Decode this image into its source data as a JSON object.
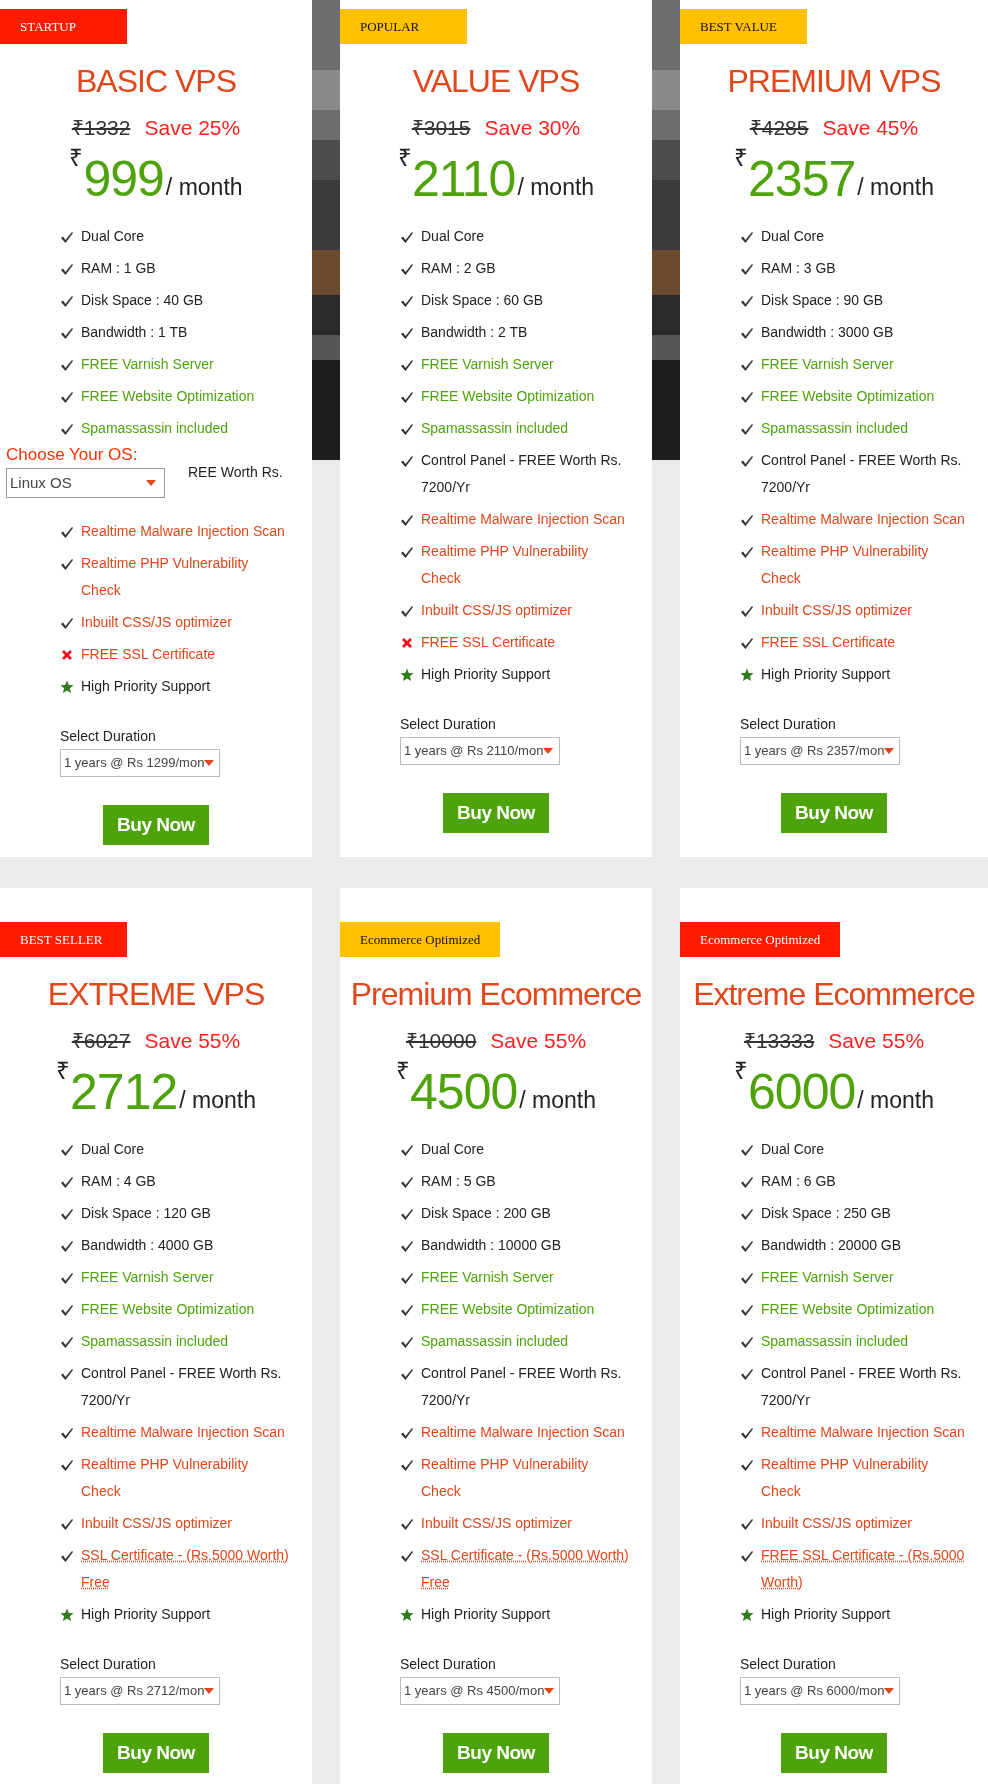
{
  "os_chooser": {
    "label": "Choose Your OS:",
    "value": "Linux OS"
  },
  "plans": [
    {
      "badge": {
        "text": "STARTUP",
        "color": "#ff1a00"
      },
      "title": "BASIC VPS",
      "old_price": "₹1332",
      "save": "Save 25%",
      "currency": "₹",
      "price": "999",
      "per": "/ month",
      "features": [
        {
          "kind": "check",
          "color": "#222222",
          "lines": [
            "Dual Core"
          ]
        },
        {
          "kind": "check",
          "color": "#222222",
          "lines": [
            "RAM : 1 GB"
          ]
        },
        {
          "kind": "check",
          "color": "#222222",
          "lines": [
            "Disk Space : 40 GB"
          ]
        },
        {
          "kind": "check",
          "color": "#222222",
          "lines": [
            "Bandwidth : 1 TB"
          ]
        },
        {
          "kind": "check",
          "color": "#4ea30a",
          "lines": [
            "FREE Varnish Server"
          ]
        },
        {
          "kind": "check",
          "color": "#4ea30a",
          "lines": [
            "FREE Website Optimization"
          ]
        },
        {
          "kind": "check",
          "color": "#4ea30a",
          "lines": [
            "Spamassassin included"
          ]
        },
        {
          "kind": "covered",
          "color": "#222222",
          "lines": [
            "REE Worth Rs."
          ]
        },
        {
          "kind": "check",
          "color": "#e2461b",
          "lines": [
            "Realtime Malware Injection Scan"
          ]
        },
        {
          "kind": "check",
          "color": "#e2461b",
          "lines": [
            "Realtime PHP Vulnerability",
            "Check"
          ]
        },
        {
          "kind": "check",
          "color": "#e2461b",
          "lines": [
            "Inbuilt CSS/JS optimizer"
          ]
        },
        {
          "kind": "cross",
          "color": "#e2461b",
          "lines": [
            "FREE SSL Certificate"
          ]
        },
        {
          "kind": "star",
          "color": "#222222",
          "lines": [
            "High Priority Support"
          ]
        }
      ],
      "duration_label": "Select Duration",
      "duration": "1 years @ Rs 1299/mon",
      "button": "Buy Now"
    },
    {
      "badge": {
        "text": "POPULAR",
        "color": "#ffc000"
      },
      "title": "VALUE VPS",
      "old_price": "₹3015",
      "save": "Save 30%",
      "currency": "₹",
      "price": "2110",
      "per": "/ month",
      "features": [
        {
          "kind": "check",
          "color": "#222222",
          "lines": [
            "Dual Core"
          ]
        },
        {
          "kind": "check",
          "color": "#222222",
          "lines": [
            "RAM : 2 GB"
          ]
        },
        {
          "kind": "check",
          "color": "#222222",
          "lines": [
            "Disk Space : 60 GB"
          ]
        },
        {
          "kind": "check",
          "color": "#222222",
          "lines": [
            "Bandwidth : 2 TB"
          ]
        },
        {
          "kind": "check",
          "color": "#4ea30a",
          "lines": [
            "FREE Varnish Server"
          ]
        },
        {
          "kind": "check",
          "color": "#4ea30a",
          "lines": [
            "FREE Website Optimization"
          ]
        },
        {
          "kind": "check",
          "color": "#4ea30a",
          "lines": [
            "Spamassassin included"
          ]
        },
        {
          "kind": "check",
          "color": "#222222",
          "lines": [
            "Control Panel - FREE Worth Rs.",
            "7200/Yr"
          ]
        },
        {
          "kind": "check",
          "color": "#e2461b",
          "lines": [
            "Realtime Malware Injection Scan"
          ]
        },
        {
          "kind": "check",
          "color": "#e2461b",
          "lines": [
            "Realtime PHP Vulnerability",
            "Check"
          ]
        },
        {
          "kind": "check",
          "color": "#e2461b",
          "lines": [
            "Inbuilt CSS/JS optimizer"
          ]
        },
        {
          "kind": "cross",
          "color": "#e2461b",
          "lines": [
            "FREE SSL Certificate"
          ]
        },
        {
          "kind": "star",
          "color": "#222222",
          "lines": [
            "High Priority Support"
          ]
        }
      ],
      "duration_label": "Select Duration",
      "duration": "1 years @ Rs 2110/mon",
      "button": "Buy Now"
    },
    {
      "badge": {
        "text": "BEST VALUE",
        "color": "#ffc000"
      },
      "title": "PREMIUM VPS",
      "old_price": "₹4285",
      "save": "Save 45%",
      "currency": "₹",
      "price": "2357",
      "per": "/ month",
      "features": [
        {
          "kind": "check",
          "color": "#222222",
          "lines": [
            "Dual Core"
          ]
        },
        {
          "kind": "check",
          "color": "#222222",
          "lines": [
            "RAM : 3 GB"
          ]
        },
        {
          "kind": "check",
          "color": "#222222",
          "lines": [
            "Disk Space : 90 GB"
          ]
        },
        {
          "kind": "check",
          "color": "#222222",
          "lines": [
            "Bandwidth : 3000 GB"
          ]
        },
        {
          "kind": "check",
          "color": "#4ea30a",
          "lines": [
            "FREE Varnish Server"
          ]
        },
        {
          "kind": "check",
          "color": "#4ea30a",
          "lines": [
            "FREE Website Optimization"
          ]
        },
        {
          "kind": "check",
          "color": "#4ea30a",
          "lines": [
            "Spamassassin included"
          ]
        },
        {
          "kind": "check",
          "color": "#222222",
          "lines": [
            "Control Panel - FREE Worth Rs.",
            "7200/Yr"
          ]
        },
        {
          "kind": "check",
          "color": "#e2461b",
          "lines": [
            "Realtime Malware Injection Scan"
          ]
        },
        {
          "kind": "check",
          "color": "#e2461b",
          "lines": [
            "Realtime PHP Vulnerability",
            "Check"
          ]
        },
        {
          "kind": "check",
          "color": "#e2461b",
          "lines": [
            "Inbuilt CSS/JS optimizer"
          ]
        },
        {
          "kind": "check",
          "color": "#e2461b",
          "lines": [
            "FREE SSL Certificate"
          ]
        },
        {
          "kind": "star",
          "color": "#222222",
          "lines": [
            "High Priority Support"
          ]
        }
      ],
      "duration_label": "Select Duration",
      "duration": "1 years @ Rs 2357/mon",
      "button": "Buy Now"
    },
    {
      "badge": {
        "text": "BEST SELLER",
        "color": "#ff1a00"
      },
      "title": "EXTREME VPS",
      "old_price": "₹6027",
      "save": "Save 55%",
      "currency": "₹",
      "price": "2712",
      "per": "/ month",
      "features": [
        {
          "kind": "check",
          "color": "#222222",
          "lines": [
            "Dual Core"
          ]
        },
        {
          "kind": "check",
          "color": "#222222",
          "lines": [
            "RAM : 4 GB"
          ]
        },
        {
          "kind": "check",
          "color": "#222222",
          "lines": [
            "Disk Space : 120 GB"
          ]
        },
        {
          "kind": "check",
          "color": "#222222",
          "lines": [
            "Bandwidth : 4000 GB"
          ]
        },
        {
          "kind": "check",
          "color": "#4ea30a",
          "lines": [
            "FREE Varnish Server"
          ]
        },
        {
          "kind": "check",
          "color": "#4ea30a",
          "lines": [
            "FREE Website Optimization"
          ]
        },
        {
          "kind": "check",
          "color": "#4ea30a",
          "lines": [
            "Spamassassin included"
          ]
        },
        {
          "kind": "check",
          "color": "#222222",
          "lines": [
            "Control Panel - FREE Worth Rs.",
            "7200/Yr"
          ]
        },
        {
          "kind": "check",
          "color": "#e2461b",
          "lines": [
            "Realtime Malware Injection Scan"
          ]
        },
        {
          "kind": "check",
          "color": "#e2461b",
          "lines": [
            "Realtime PHP Vulnerability",
            "Check"
          ]
        },
        {
          "kind": "check",
          "color": "#e2461b",
          "lines": [
            "Inbuilt CSS/JS optimizer"
          ]
        },
        {
          "kind": "check",
          "color": "#e2461b",
          "dotted": true,
          "lines": [
            "SSL Certificate - (Rs.5000 Worth)",
            "Free"
          ]
        },
        {
          "kind": "star",
          "color": "#222222",
          "lines": [
            "High Priority Support"
          ]
        }
      ],
      "duration_label": "Select Duration",
      "duration": "1 years @ Rs 2712/mon",
      "button": "Buy Now"
    },
    {
      "badge": {
        "text": "Ecommerce Optimized",
        "color": "#ffc000"
      },
      "title": "Premium Ecommerce",
      "old_price": "₹10000",
      "save": "Save 55%",
      "currency": "₹",
      "price": "4500",
      "per": "/ month",
      "features": [
        {
          "kind": "check",
          "color": "#222222",
          "lines": [
            "Dual Core"
          ]
        },
        {
          "kind": "check",
          "color": "#222222",
          "lines": [
            "RAM : 5 GB"
          ]
        },
        {
          "kind": "check",
          "color": "#222222",
          "lines": [
            "Disk Space : 200 GB"
          ]
        },
        {
          "kind": "check",
          "color": "#222222",
          "lines": [
            "Bandwidth : 10000 GB"
          ]
        },
        {
          "kind": "check",
          "color": "#4ea30a",
          "lines": [
            "FREE Varnish Server"
          ]
        },
        {
          "kind": "check",
          "color": "#4ea30a",
          "lines": [
            "FREE Website Optimization"
          ]
        },
        {
          "kind": "check",
          "color": "#4ea30a",
          "lines": [
            "Spamassassin included"
          ]
        },
        {
          "kind": "check",
          "color": "#222222",
          "lines": [
            "Control Panel - FREE Worth Rs.",
            "7200/Yr"
          ]
        },
        {
          "kind": "check",
          "color": "#e2461b",
          "lines": [
            "Realtime Malware Injection Scan"
          ]
        },
        {
          "kind": "check",
          "color": "#e2461b",
          "lines": [
            "Realtime PHP Vulnerability",
            "Check"
          ]
        },
        {
          "kind": "check",
          "color": "#e2461b",
          "lines": [
            "Inbuilt CSS/JS optimizer"
          ]
        },
        {
          "kind": "check",
          "color": "#e2461b",
          "dotted": true,
          "lines": [
            "SSL Certificate - (Rs.5000 Worth)",
            "Free"
          ]
        },
        {
          "kind": "star",
          "color": "#222222",
          "lines": [
            "High Priority Support"
          ]
        }
      ],
      "duration_label": "Select Duration",
      "duration": "1 years @ Rs 4500/mon",
      "button": "Buy Now"
    },
    {
      "badge": {
        "text": "Ecommerce Optimized",
        "color": "#ff1a00"
      },
      "title": "Extreme Ecommerce",
      "old_price": "₹13333",
      "save": "Save 55%",
      "currency": "₹",
      "price": "6000",
      "per": "/ month",
      "features": [
        {
          "kind": "check",
          "color": "#222222",
          "lines": [
            "Dual Core"
          ]
        },
        {
          "kind": "check",
          "color": "#222222",
          "lines": [
            "RAM : 6 GB"
          ]
        },
        {
          "kind": "check",
          "color": "#222222",
          "lines": [
            "Disk Space : 250 GB"
          ]
        },
        {
          "kind": "check",
          "color": "#222222",
          "lines": [
            "Bandwidth : 20000 GB"
          ]
        },
        {
          "kind": "check",
          "color": "#4ea30a",
          "lines": [
            "FREE Varnish Server"
          ]
        },
        {
          "kind": "check",
          "color": "#4ea30a",
          "lines": [
            "FREE Website Optimization"
          ]
        },
        {
          "kind": "check",
          "color": "#4ea30a",
          "lines": [
            "Spamassassin included"
          ]
        },
        {
          "kind": "check",
          "color": "#222222",
          "lines": [
            "Control Panel - FREE Worth Rs.",
            "7200/Yr"
          ]
        },
        {
          "kind": "check",
          "color": "#e2461b",
          "lines": [
            "Realtime Malware Injection Scan"
          ]
        },
        {
          "kind": "check",
          "color": "#e2461b",
          "lines": [
            "Realtime PHP Vulnerability",
            "Check"
          ]
        },
        {
          "kind": "check",
          "color": "#e2461b",
          "lines": [
            "Inbuilt CSS/JS optimizer"
          ]
        },
        {
          "kind": "check",
          "color": "#e2461b",
          "dotted": true,
          "lines": [
            "FREE SSL Certificate - (Rs.5000",
            "Worth)"
          ]
        },
        {
          "kind": "star",
          "color": "#222222",
          "lines": [
            "High Priority Support"
          ]
        }
      ],
      "duration_label": "Select Duration",
      "duration": "1 years @ Rs 6000/mon",
      "button": "Buy Now"
    }
  ]
}
